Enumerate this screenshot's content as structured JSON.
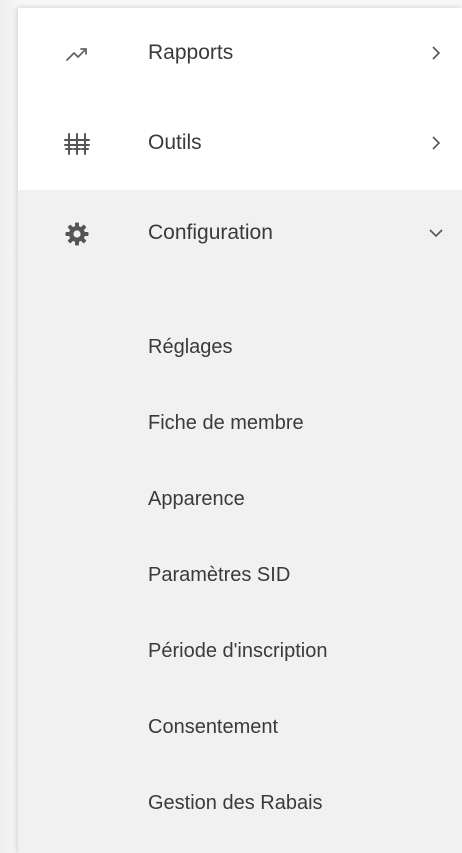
{
  "menu": {
    "items": [
      {
        "label": "Rapports",
        "icon": "trending-up-icon",
        "chevron": "chevron-right-icon"
      },
      {
        "label": "Outils",
        "icon": "tools-icon",
        "chevron": "chevron-right-icon"
      },
      {
        "label": "Configuration",
        "icon": "gear-icon",
        "chevron": "chevron-down-icon"
      }
    ],
    "submenu": [
      "Réglages",
      "Fiche de membre",
      "Apparence",
      "Paramètres SID",
      "Période d'inscription",
      "Consentement",
      "Gestion des Rabais"
    ]
  },
  "colors": {
    "text": "#3a3a3a",
    "icon": "#555555",
    "open_bg": "#f1f1f1"
  }
}
